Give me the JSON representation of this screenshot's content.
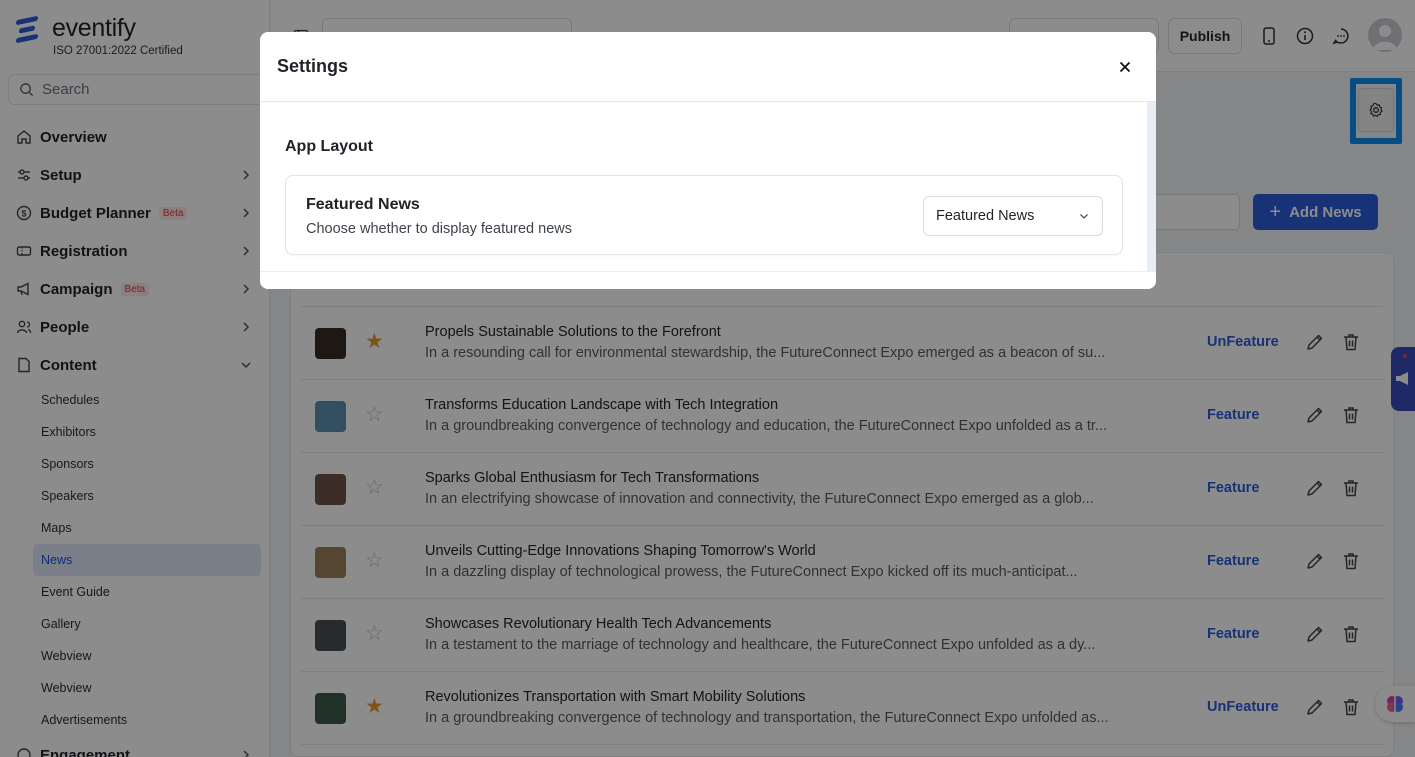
{
  "app": {
    "brand": "eventify",
    "certification": "ISO 27001:2022 Certified"
  },
  "sidebar": {
    "search_placeholder": "Search",
    "items": [
      {
        "label": "Overview",
        "icon": "home-icon",
        "chevron": false
      },
      {
        "label": "Setup",
        "icon": "sliders-icon",
        "chevron": true
      },
      {
        "label": "Budget Planner",
        "icon": "dollar-icon",
        "chevron": true,
        "badge": "Beta"
      },
      {
        "label": "Registration",
        "icon": "ticket-icon",
        "chevron": true
      },
      {
        "label": "Campaign",
        "icon": "megaphone-icon",
        "chevron": true,
        "badge": "Beta"
      },
      {
        "label": "People",
        "icon": "people-icon",
        "chevron": true
      },
      {
        "label": "Content",
        "icon": "document-icon",
        "chevron": true,
        "expanded": true
      }
    ],
    "content_subitems": [
      "Schedules",
      "Exhibitors",
      "Sponsors",
      "Speakers",
      "Maps",
      "News",
      "Event Guide",
      "Gallery",
      "Webview",
      "Webview",
      "Advertisements"
    ],
    "active_subitem": "News",
    "engagement_label": "Engagement"
  },
  "topbar": {
    "publish_label": "Publish"
  },
  "main": {
    "add_news_label": "Add News",
    "rows": [
      {
        "title": "Propels Sustainable Solutions to the Forefront",
        "desc": "In a resounding call for environmental stewardship, the FutureConnect Expo emerged as a beacon of su...",
        "featured": true,
        "action": "UnFeature",
        "thumb": "#3a2a24"
      },
      {
        "title": "Transforms Education Landscape with Tech Integration",
        "desc": "In a groundbreaking convergence of technology and education, the FutureConnect Expo unfolded as a tr...",
        "featured": false,
        "action": "Feature",
        "thumb": "#5b8fb0"
      },
      {
        "title": "Sparks Global Enthusiasm for Tech Transformations",
        "desc": "In an electrifying showcase of innovation and connectivity, the FutureConnect Expo emerged as a glob...",
        "featured": false,
        "action": "Feature",
        "thumb": "#6a5446"
      },
      {
        "title": "Unveils Cutting-Edge Innovations Shaping Tomorrow's World",
        "desc": "In a dazzling display of technological prowess, the FutureConnect Expo kicked off its much-anticipat...",
        "featured": false,
        "action": "Feature",
        "thumb": "#9a8058"
      },
      {
        "title": "Showcases Revolutionary Health Tech Advancements",
        "desc": "In a testament to the marriage of technology and healthcare, the FutureConnect Expo unfolded as a dy...",
        "featured": false,
        "action": "Feature",
        "thumb": "#4a4f55"
      },
      {
        "title": "Revolutionizes Transportation with Smart Mobility Solutions",
        "desc": "In a groundbreaking convergence of technology and transportation, the FutureConnect Expo unfolded as...",
        "featured": true,
        "action": "UnFeature",
        "thumb": "#3e5a4a"
      }
    ]
  },
  "modal": {
    "title": "Settings",
    "section": "App Layout",
    "card_title": "Featured News",
    "card_desc": "Choose whether to display featured news",
    "select_value": "Featured News"
  },
  "colors": {
    "accent": "#2b5bd9",
    "star_on": "#e69a2c",
    "highlight": "#0b8cf0"
  }
}
